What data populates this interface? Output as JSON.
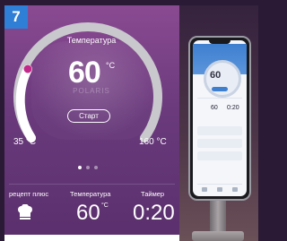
{
  "step_badge": "7",
  "main_display": {
    "title": "Температура",
    "value": "60",
    "unit": "°C",
    "mode_name": "POLARIS",
    "start_label": "Старт",
    "range_min": "35 °C",
    "range_max": "160 °C",
    "progress_fraction": 0.08
  },
  "pager": {
    "count": 3,
    "active": 0
  },
  "info_row": {
    "recipe_label": "рецепт плюс",
    "recipe_icon": "chef-hat-icon",
    "temperature_label": "Температура",
    "temperature_value": "60",
    "temperature_unit": "°C",
    "timer_label": "Таймер",
    "timer_value": "0:20"
  },
  "colors": {
    "panel_purple": "#7a4486",
    "accent_pink": "#c2298a",
    "badge_blue": "#2f7fd6",
    "phone_blue": "#3f7fd0"
  }
}
